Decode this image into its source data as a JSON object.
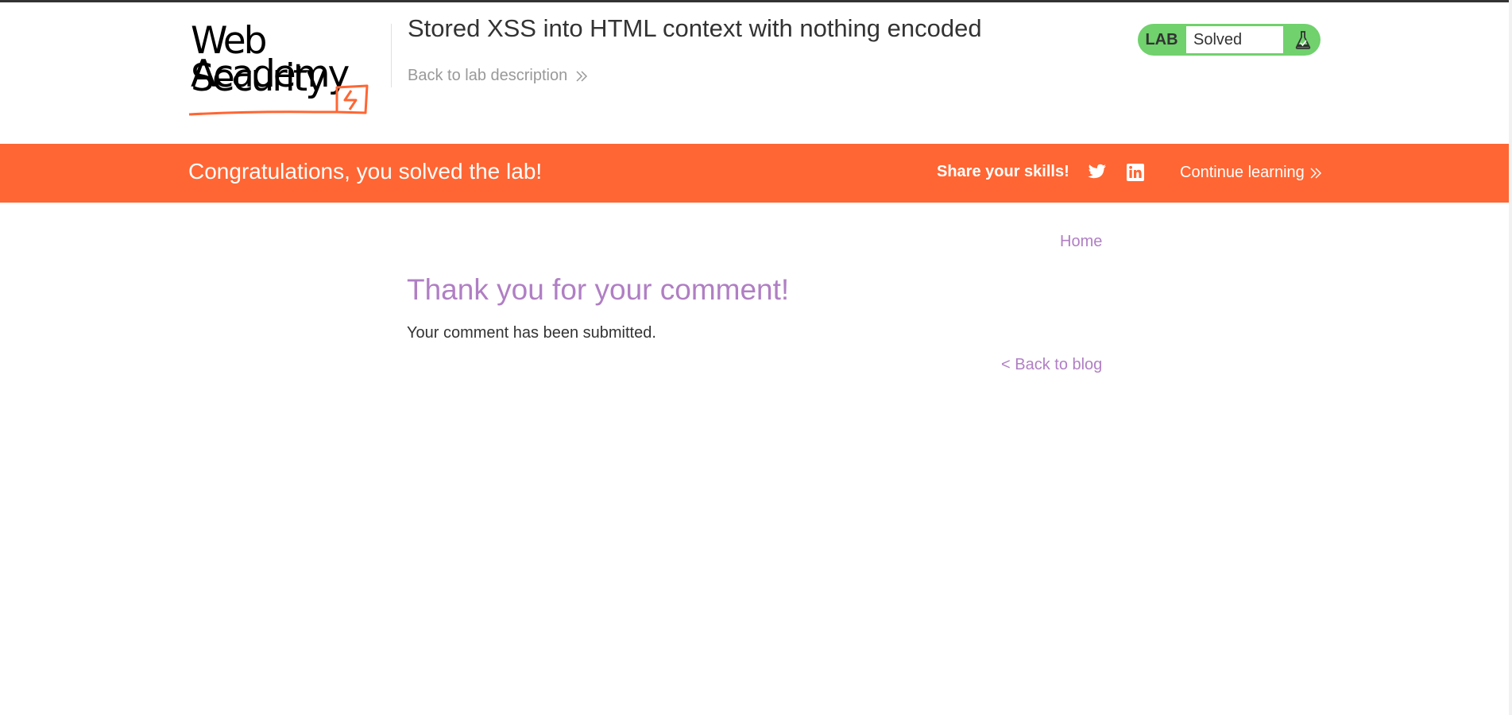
{
  "header": {
    "logo_line1": "Web Security",
    "logo_line2": "Academy",
    "lab_title": "Stored XSS into HTML context with nothing encoded",
    "back_to_description": "Back to lab description",
    "lab_badge": "LAB",
    "lab_status": "Solved",
    "icons": [
      "chevron-double-right-icon",
      "flask-icon"
    ]
  },
  "banner": {
    "message": "Congratulations, you solved the lab!",
    "share_label": "Share your skills!",
    "continue_label": "Continue learning",
    "icons": [
      "twitter-icon",
      "linkedin-icon",
      "chevron-double-right-icon"
    ]
  },
  "main": {
    "home_link": "Home",
    "heading": "Thank you for your comment!",
    "message": "Your comment has been submitted.",
    "back_link": "< Back to blog"
  },
  "colors": {
    "banner": "#ff6633",
    "status_green": "#70d16d",
    "link_purple": "#b07fc4",
    "text": "#333333",
    "muted": "#999999"
  }
}
